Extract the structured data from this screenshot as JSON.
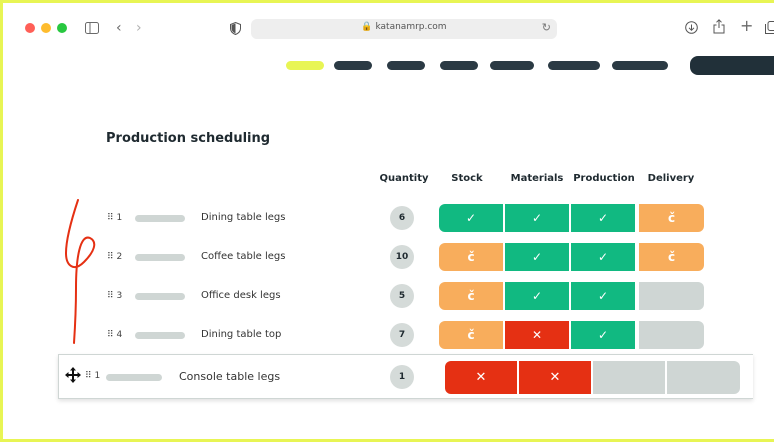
{
  "browser": {
    "url": "katanamrp.com",
    "traffic_lights": [
      "#ff5f57",
      "#febc2e",
      "#28c840"
    ],
    "icons": [
      "sidebar-icon",
      "back-icon",
      "forward-icon",
      "shield-icon",
      "lock-icon",
      "reload-icon",
      "download-icon",
      "share-icon",
      "new-tab-icon",
      "tabs-icon"
    ]
  },
  "brand_colors": {
    "highlight": "#e8f554",
    "dark": "#213039",
    "green": "#11b981",
    "orange": "#f8ad5c",
    "red": "#e53013",
    "empty": "#cfd6d4"
  },
  "page": {
    "title": "Production scheduling",
    "columns": [
      "Quantity",
      "Stock",
      "Materials",
      "Production",
      "Delivery"
    ],
    "rows": [
      {
        "num": "1",
        "name": "Dining table legs",
        "qty": "6",
        "status": [
          "done",
          "done",
          "done",
          "pending"
        ]
      },
      {
        "num": "2",
        "name": "Coffee table legs",
        "qty": "10",
        "status": [
          "pending",
          "done",
          "done",
          "pending"
        ]
      },
      {
        "num": "3",
        "name": "Office desk legs",
        "qty": "5",
        "status": [
          "pending",
          "done",
          "done",
          "empty"
        ]
      },
      {
        "num": "4",
        "name": "Dining table top",
        "qty": "7",
        "status": [
          "pending",
          "blocked",
          "done",
          "empty"
        ]
      }
    ],
    "dragged_row": {
      "num": "1",
      "name": "Console table legs",
      "qty": "1",
      "status": [
        "blocked",
        "blocked",
        "empty",
        "empty"
      ]
    }
  }
}
